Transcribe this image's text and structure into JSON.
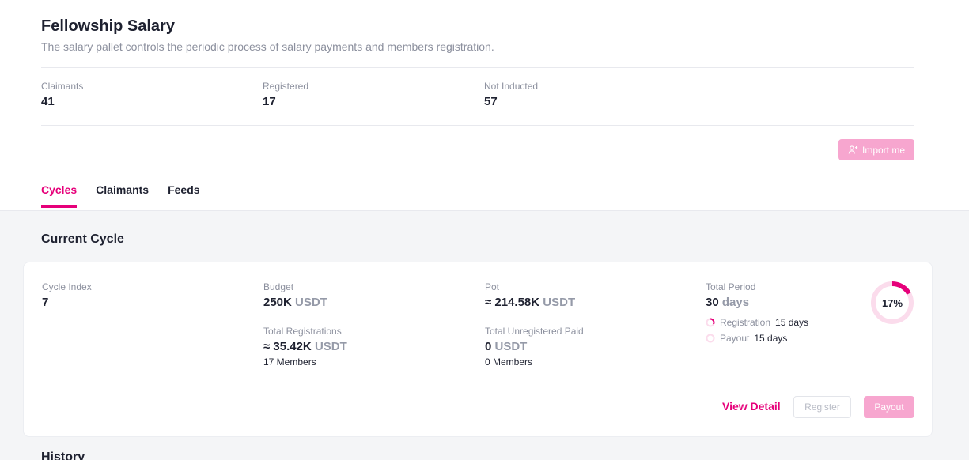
{
  "header": {
    "title": "Fellowship Salary",
    "subtitle": "The salary pallet controls the periodic process of salary payments and members registration."
  },
  "stats": [
    {
      "label": "Claimants",
      "value": "41"
    },
    {
      "label": "Registered",
      "value": "17"
    },
    {
      "label": "Not Inducted",
      "value": "57"
    }
  ],
  "import_button": {
    "label": "Import me",
    "icon": "user-import-icon"
  },
  "tabs": [
    {
      "label": "Cycles",
      "active": true
    },
    {
      "label": "Claimants",
      "active": false
    },
    {
      "label": "Feeds",
      "active": false
    }
  ],
  "current_cycle": {
    "section_title": "Current Cycle",
    "cycle_index": {
      "label": "Cycle Index",
      "value": "7"
    },
    "budget": {
      "label": "Budget",
      "value": "250K",
      "unit": "USDT"
    },
    "total_registrations": {
      "label": "Total Registrations",
      "value": "≈ 35.42K",
      "unit": "USDT",
      "members": "17 Members"
    },
    "pot": {
      "label": "Pot",
      "value": "≈ 214.58K",
      "unit": "USDT"
    },
    "total_unregistered_paid": {
      "label": "Total Unregistered Paid",
      "value": "0",
      "unit": "USDT",
      "members": "0 Members"
    },
    "total_period": {
      "label": "Total Period",
      "value": "30",
      "unit": "days"
    },
    "registration": {
      "label": "Registration",
      "value": "15 days"
    },
    "payout": {
      "label": "Payout",
      "value": "15 days"
    },
    "progress": {
      "text": "17%",
      "fraction": 0.17
    },
    "view_detail_label": "View Detail",
    "register_label": "Register",
    "payout_label": "Payout"
  },
  "history_title": "History",
  "colors": {
    "accent": "#e6007a",
    "accent_light": "#f7a6cf",
    "ring_bg": "#fbdcec"
  }
}
